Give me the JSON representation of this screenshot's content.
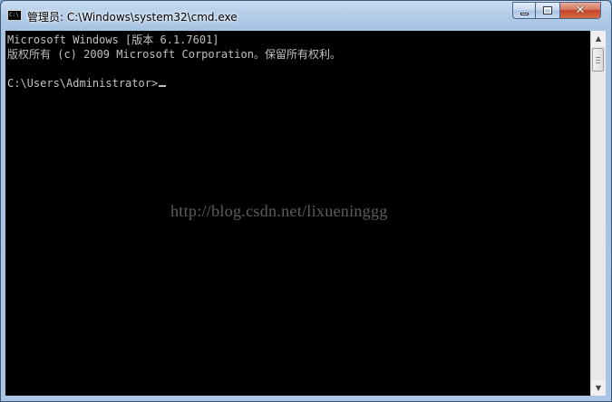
{
  "window": {
    "title": "管理员: C:\\Windows\\system32\\cmd.exe",
    "app_icon": "cmd-icon",
    "app_icon_text": "C:\\",
    "buttons": {
      "minimize": "minimize-icon",
      "maximize": "maximize-icon",
      "close_glyph": "✕"
    }
  },
  "console": {
    "lines": [
      "Microsoft Windows [版本 6.1.7601]",
      "版权所有 (c) 2009 Microsoft Corporation。保留所有权利。",
      "",
      "C:\\Users\\Administrator>"
    ],
    "text_color": "#c0c0c0",
    "background": "#000000"
  },
  "watermark": "http://blog.csdn.net/lixueninggg",
  "scrollbar": {
    "up_glyph": "▲",
    "down_glyph": "▼"
  }
}
